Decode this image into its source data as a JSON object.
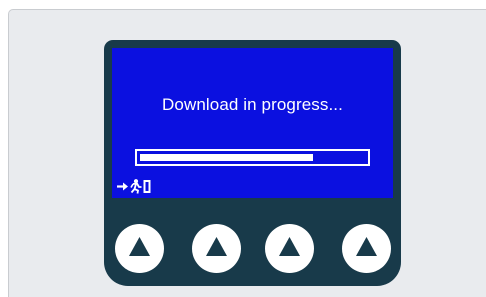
{
  "screen": {
    "message": "Download in progress...",
    "progress_fraction": 0.77,
    "exit_icon": "exit-arrow-icon"
  },
  "buttons": [
    {
      "icon": "triangle-up-icon"
    },
    {
      "icon": "triangle-up-icon"
    },
    {
      "icon": "triangle-up-icon"
    },
    {
      "icon": "triangle-up-icon"
    }
  ],
  "colors": {
    "background": "#e9ebee",
    "device_body": "#183a4a",
    "screen": "#0b10e0",
    "text": "#ffffff",
    "button": "#ffffff",
    "button_glyph": "#183a4a"
  }
}
